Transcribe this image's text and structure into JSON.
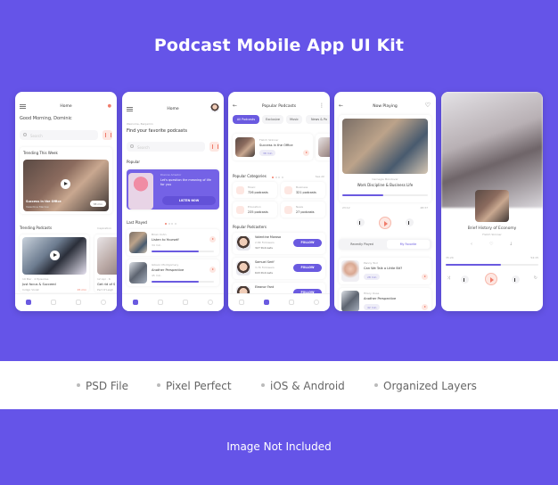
{
  "title": "Podcast Mobile App UI Kit",
  "features": [
    "PSD File",
    "Pixel Perfect",
    "iOS & Android",
    "Organized Layers"
  ],
  "footer_note": "Image Not Included",
  "colors": {
    "accent": "#6a5ae0",
    "background": "#6554e8",
    "highlight": "#f07c6b"
  },
  "screen1": {
    "header": "Home",
    "greeting": "Good Morning, Dominic",
    "search_placeholder": "Search",
    "trending_week": {
      "label": "Trending This Week",
      "episode": "Success in the Office",
      "author": "Valentine Marlow",
      "duration": "38 min"
    },
    "trending_podcasts": {
      "label": "Trending Podcasts",
      "see_all": "Inspiration",
      "items": [
        {
          "meta": "19 Mar · 4 Episodes",
          "title": "Just focus & Succeed",
          "author": "Indigo Violet",
          "duration": "45 min"
        },
        {
          "meta": "12 Apr · 6",
          "title": "Get rid of S",
          "author": "Pert O'Leigh"
        }
      ]
    }
  },
  "screen2": {
    "header": "Home",
    "welcome": "Welcome, Benjamin",
    "headline": "Find your favorite podcasts",
    "search_placeholder": "Search",
    "popular": {
      "label": "Popular",
      "author": "Dianne Amador",
      "text": "Let's question the meaning of life for you",
      "button": "LISTEN NOW"
    },
    "last_played": {
      "label": "Last Played",
      "items": [
        {
          "author": "Brian Cohn",
          "title": "Listen to Yourself",
          "duration": "34 min",
          "progress": 0.75
        },
        {
          "author": "Gibson Montgomery",
          "title": "Another Perspective",
          "duration": "45 min",
          "progress": 0.75
        }
      ]
    }
  },
  "screen3": {
    "header": "Popular Podcasts",
    "chips": [
      "All Podcasts",
      "Exclusive",
      "Music",
      "News & Po"
    ],
    "featured": {
      "author": "Fletch Skinner",
      "title": "Success in the Office",
      "duration": "38 min"
    },
    "categories": {
      "label": "Popular Categories",
      "see_all": "See All",
      "items": [
        {
          "name": "Music",
          "count": "726 podcasts"
        },
        {
          "name": "Business",
          "count": "321 podcasts"
        },
        {
          "name": "Education",
          "count": "235 podcasts"
        },
        {
          "name": "News",
          "count": "27 podcasts"
        }
      ]
    },
    "podcasters": {
      "label": "Popular Podcasters",
      "follow": "FOLLOW",
      "items": [
        {
          "name": "Valentine Morosa",
          "followers": "2.8K Followers",
          "podcasts": "327 Podcasts"
        },
        {
          "name": "Samuel Serif",
          "followers": "3.7K Followers",
          "podcasts": "643 Podcasts"
        },
        {
          "name": "Eleanor Fant"
        }
      ]
    }
  },
  "screen4": {
    "header": "Now Playing",
    "author": "Carnegie Mondover",
    "title": "Work Discipline & Business Life",
    "elapsed": "23:12",
    "total": "48:37",
    "progress": 0.48,
    "tabs": [
      "Recently Played",
      "My Favorite"
    ],
    "items": [
      {
        "author": "Penny Tool",
        "title": "Can We Talk a Little Bit?",
        "duration": "28 min"
      },
      {
        "author": "Hilary Ouse",
        "title": "Another Perspective",
        "duration": "42 min"
      }
    ]
  },
  "screen5": {
    "title": "Brief History of Economy",
    "author": "Fletch Skinner",
    "elapsed": "35:24",
    "total": "54:15",
    "progress": 0.6
  }
}
